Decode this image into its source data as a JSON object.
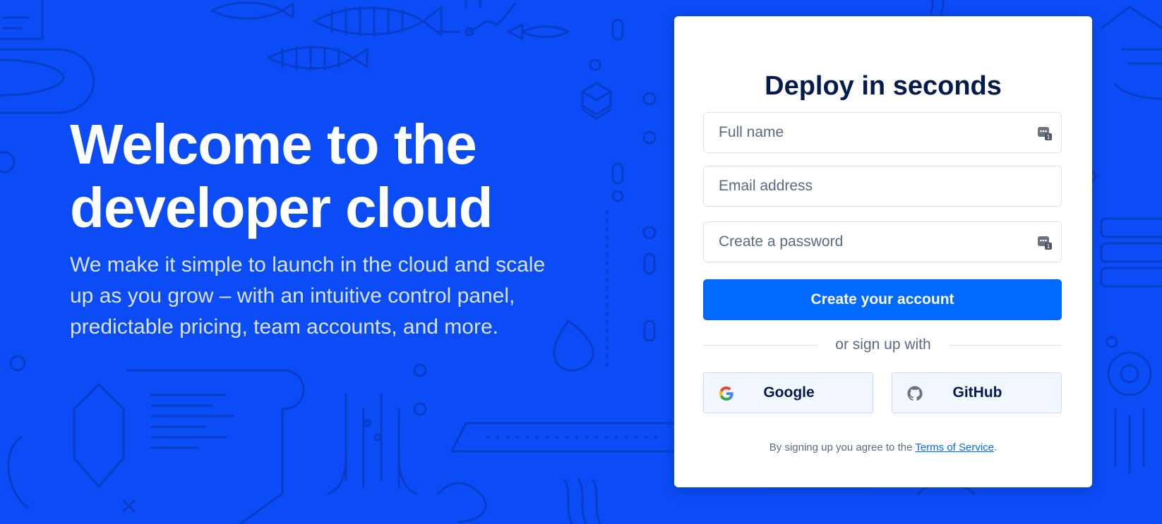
{
  "hero": {
    "headline_line1": "Welcome to the",
    "headline_line2": "developer cloud",
    "subcopy": "We make it simple to launch in the cloud and scale up as you grow – with an intuitive control panel, predictable pricing, team accounts, and more."
  },
  "signup": {
    "title": "Deploy in seconds",
    "fields": {
      "full_name": {
        "placeholder": "Full name",
        "value": ""
      },
      "email": {
        "placeholder": "Email address",
        "value": ""
      },
      "password": {
        "placeholder": "Create a password",
        "value": ""
      }
    },
    "field_icon": "password-manager-icon",
    "submit_label": "Create your account",
    "divider_text": "or sign up with",
    "social": {
      "google_label": "Google",
      "google_icon": "google-icon",
      "github_label": "GitHub",
      "github_icon": "github-icon"
    },
    "terms_prefix": "By signing up you agree to the",
    "terms_link": "Terms of Service",
    "terms_suffix": "."
  },
  "colors": {
    "background": "#0b4cf6",
    "primary_button": "#0069ff",
    "title_text": "#031b4e",
    "social_button_bg": "#f1f6ff"
  }
}
